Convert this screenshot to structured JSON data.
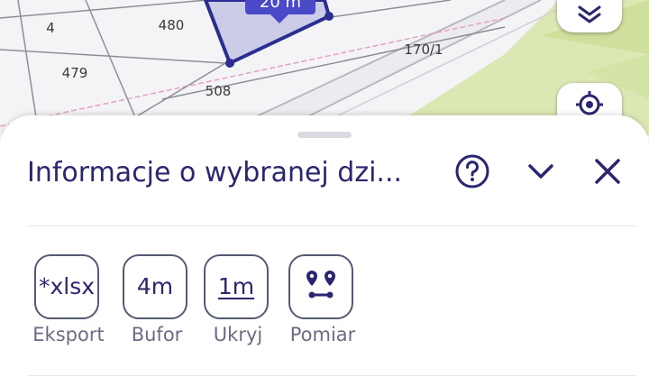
{
  "map": {
    "parcels": [
      "4",
      "480",
      "479",
      "508",
      "170/1"
    ],
    "measure_label": "20 m",
    "layers_button_icon": "layers-icon",
    "locate_button_icon": "locate-icon"
  },
  "panel": {
    "title": "Informacje o wybranej dzi...",
    "help_icon": "help-icon",
    "collapse_icon": "chevron-down-icon",
    "close_icon": "close-icon"
  },
  "tools": [
    {
      "label": "Eksport",
      "icon_text": "*xlsx",
      "icon": "export-xlsx-icon"
    },
    {
      "label": "Bufor",
      "icon_text": "4m",
      "icon": "buffer-icon"
    },
    {
      "label": "Ukryj",
      "icon_text": "1m",
      "icon": "ruler-icon"
    },
    {
      "label": "Pomiar",
      "icon_text": "",
      "icon": "measure-route-icon"
    }
  ],
  "colors": {
    "accent": "#2b2670",
    "parcel_highlight": "#2b2d8f",
    "map_green": "#dce8b4"
  }
}
